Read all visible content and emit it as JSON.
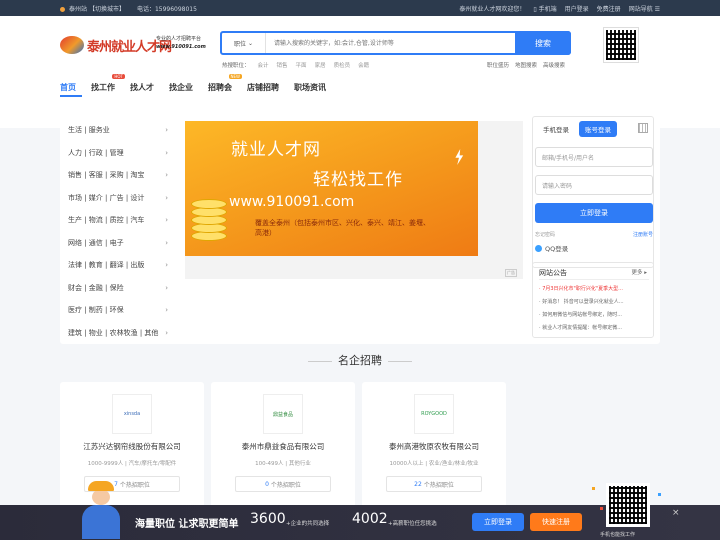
{
  "topbar": {
    "station": "泰州站",
    "switch_city": "【切换城市】",
    "phone_label": "电话：15996098015",
    "welcome": "泰州就业人才网欢迎您！",
    "mobile": "手机端",
    "user_login": "用户登录",
    "free_register": "免费注册",
    "site_nav": "网站导航"
  },
  "logo": {
    "name": "泰州就业人才网",
    "slogan": "专业的人才招聘平台",
    "url": "www.910091.com"
  },
  "search": {
    "category": "职位",
    "placeholder": "请输入搜索的关键字，如:会计,仓管,设计师等",
    "button": "搜索",
    "hot_label": "热搜职位：",
    "hot": [
      "会计",
      "销售",
      "平面",
      "家居",
      "质检员",
      "会籍"
    ],
    "links": [
      "职位盛历",
      "地图搜索",
      "高级搜索"
    ]
  },
  "nav": {
    "items": [
      {
        "label": "首页",
        "badge": ""
      },
      {
        "label": "找工作",
        "badge": "HOT"
      },
      {
        "label": "找人才",
        "badge": ""
      },
      {
        "label": "找企业",
        "badge": ""
      },
      {
        "label": "招聘会",
        "badge": "NEW"
      },
      {
        "label": "店铺招聘",
        "badge": ""
      },
      {
        "label": "职场资讯",
        "badge": ""
      }
    ]
  },
  "categories": [
    "生活 | 服务业",
    "人力 | 行政 | 管理",
    "销售 | 客服 | 采购 | 淘宝",
    "市场 | 媒介 | 广告 | 设计",
    "生产 | 物流 | 质控 | 汽车",
    "网络 | 通信 | 电子",
    "法律 | 教育 | 翻译 | 出版",
    "财会 | 金融 | 保险",
    "医疗 | 制药 | 环保",
    "建筑 | 物业 | 农林牧渔 | 其他"
  ],
  "banner": {
    "line1": "就业人才网",
    "line2": "轻松找工作",
    "url": "www.910091.com",
    "coverage": "覆盖全泰州（包括泰州市区、兴化、泰兴、靖江、姜堰、高港）",
    "ad": "广告"
  },
  "login": {
    "tab_mobile": "手机登录",
    "tab_account": "账号登录",
    "user_placeholder": "邮箱/手机号/用户名",
    "pass_placeholder": "请输入密码",
    "submit": "立即登录",
    "forgot": "忘记密码",
    "register": "注册账号",
    "qq": "QQ登录"
  },
  "notice": {
    "title": "网站公告",
    "more": "更多",
    "items": [
      "7月3日兴化市\"职行兴化\"夏季大型...",
      "好消息！ 抖音可以登录兴化就业人...",
      "如何用微信与网站帐号绑定，随时...",
      "就业人才网友情提醒：帐号绑定微..."
    ]
  },
  "section_title": "名企招聘",
  "companies": [
    {
      "logo": "xinsda",
      "name": "江苏兴达钢帘线股份有限公司",
      "meta": "1000-9999人 | 汽车/摩托车/零配件",
      "jobs": "7",
      "jobs_label": "个热招职位"
    },
    {
      "logo": "鼎益食品",
      "name": "泰州市鼎益食品有限公司",
      "meta": "100-499人 | 其他行业",
      "jobs": "0",
      "jobs_label": "个热招职位"
    },
    {
      "logo": "ROYGOOD",
      "name": "泰州高港牧原农牧有限公司",
      "meta": "10000人以上 | 农业/渔业/林业/牧业",
      "jobs": "22",
      "jobs_label": "个热招职位"
    }
  ],
  "footer": {
    "slogan": "海量职位 让求职更简单",
    "num1": "3600",
    "num1_label": "+企业的共同选择",
    "num2": "4002",
    "num2_label": "+高薪职位任您挑选",
    "login_btn": "立即登录",
    "register_btn": "快速注册",
    "qr_text": "手机也能找工作",
    "close": "×"
  },
  "colors": {
    "accent": "#2f7cf6",
    "orange": "#ff7a1a",
    "topbar": "#2c3a4d"
  }
}
